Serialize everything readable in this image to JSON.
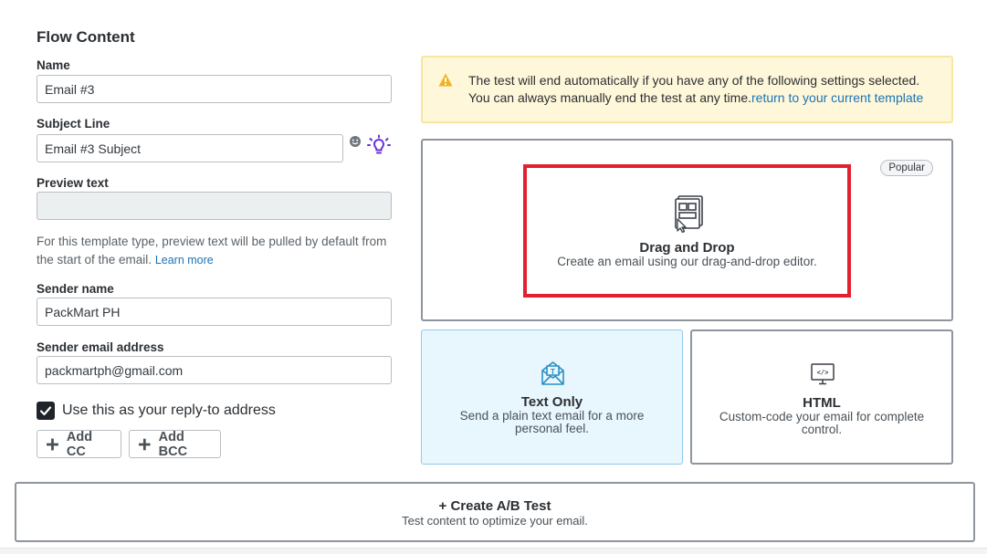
{
  "section_title": "Flow Content",
  "fields": {
    "name": {
      "label": "Name",
      "value": "Email #3"
    },
    "subject": {
      "label": "Subject Line",
      "value": "Email #3 Subject"
    },
    "preview": {
      "label": "Preview text",
      "value": ""
    },
    "preview_help": "For this template type, preview text will be pulled by default from the start of the email.",
    "learn_more": "Learn more",
    "sender_name": {
      "label": "Sender name",
      "value": "PackMart PH"
    },
    "sender_email": {
      "label": "Sender email address",
      "value": "packmartph@gmail.com"
    }
  },
  "reply_to": {
    "label": "Use this as your reply-to address",
    "checked": true
  },
  "buttons": {
    "add_cc": "Add CC",
    "add_bcc": "Add BCC"
  },
  "alert": {
    "line1": "The test will end automatically if you have any of the following settings selected.",
    "line2": "You can always manually end the test at any time.",
    "link": "return to your current template"
  },
  "templates": {
    "drag_drop": {
      "title": "Drag and Drop",
      "desc": "Create an email using our drag-and-drop editor.",
      "badge": "Popular"
    },
    "text_only": {
      "title": "Text Only",
      "desc_line1": "Send a plain text email for a more",
      "desc_line2": "personal feel."
    },
    "html": {
      "title": "HTML",
      "desc_line1": "Custom-code your email for complete",
      "desc_line2": "control."
    }
  },
  "ab_test": {
    "title": "+ Create A/B Test",
    "desc": "Test content to optimize your email."
  },
  "colors": {
    "accent_link": "#1b74b8",
    "highlight": "#e3202f",
    "selected_bg": "#e8f6fd",
    "alert_bg": "#fef7d9",
    "bulb": "#6b2fd6"
  }
}
